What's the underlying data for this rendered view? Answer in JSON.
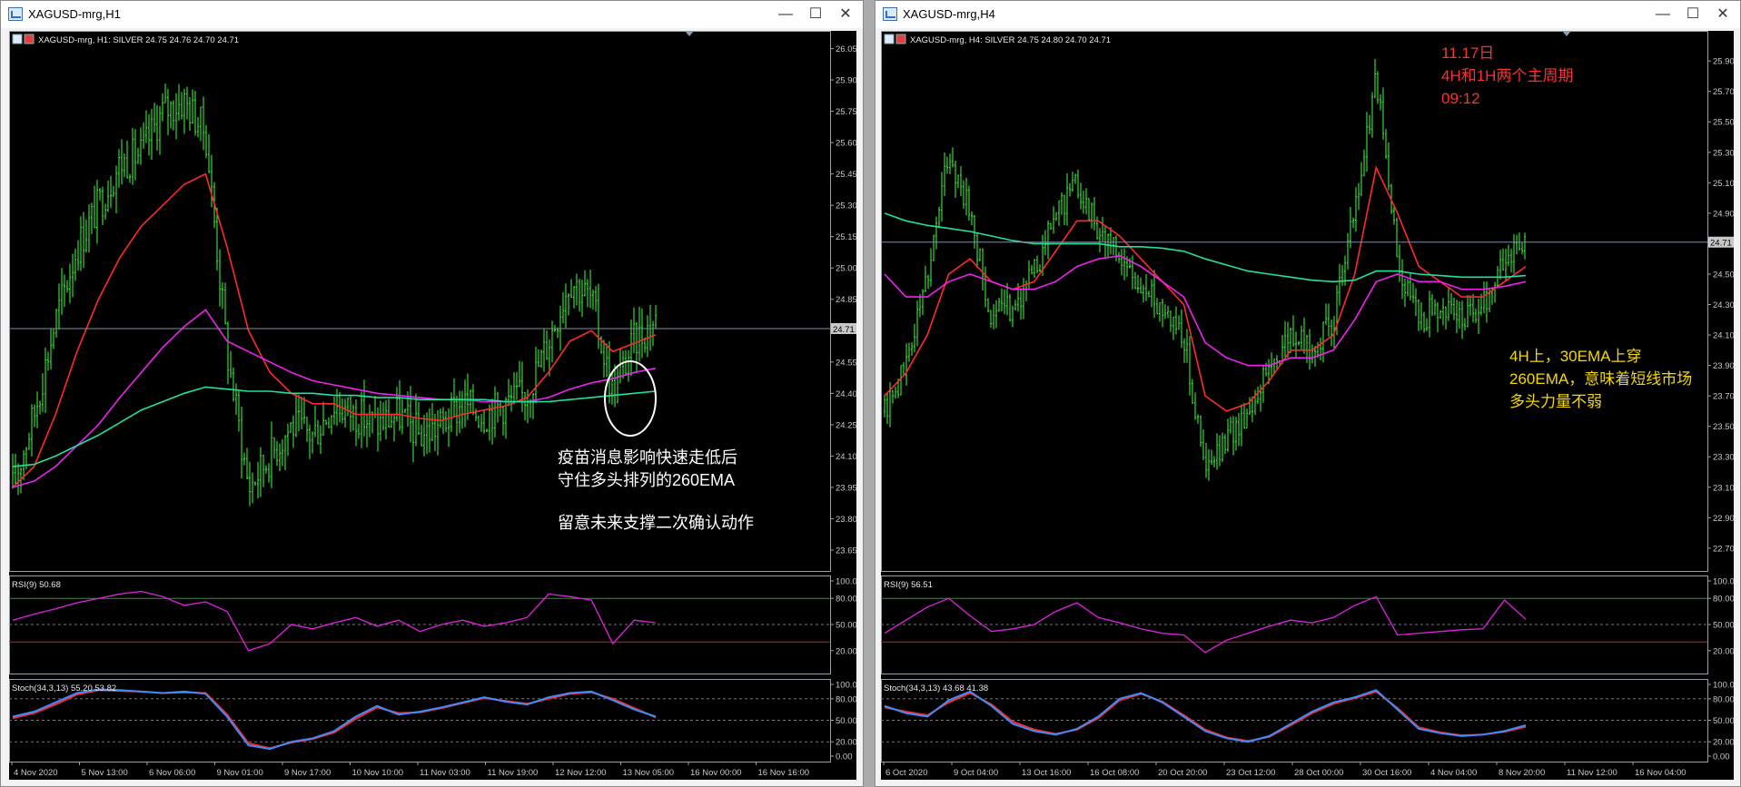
{
  "windows": [
    {
      "title": "XAGUSD-mrg,H1",
      "header": "XAGUSD-mrg, H1:  SILVER  24.75 24.76 24.70 24.71",
      "price_tag": "24.71",
      "rsi_label": "RSI(9) 50.68",
      "stoch_label": "Stoch(34,3,13) 55.20 53.82",
      "annotations": [
        {
          "text": "疫苗消息影响快速走低后",
          "color": "#ffffff"
        },
        {
          "text": "守住多头排列的260EMA",
          "color": "#ffffff"
        },
        {
          "text": "留意未来支撑二次确认动作",
          "color": "#ffffff"
        }
      ]
    },
    {
      "title": "XAGUSD-mrg,H4",
      "header": "XAGUSD-mrg, H4:  SILVER  24.75 24.80 24.70 24.71",
      "price_tag": "24.71",
      "rsi_label": "RSI(9) 56.51",
      "stoch_label": "Stoch(34,3,13) 43.68 41.38",
      "annotations": [
        {
          "text": "11.17日",
          "color": "#ff3030"
        },
        {
          "text": "4H和1H两个主周期",
          "color": "#ff3030"
        },
        {
          "text": "09:12",
          "color": "#ff3030"
        },
        {
          "text": "4H上，30EMA上穿",
          "color": "#f5d800"
        },
        {
          "text": "260EMA，意味着短线市场",
          "color": "#f5d800"
        },
        {
          "text": "多头力量不弱",
          "color": "#f5d800"
        }
      ]
    }
  ],
  "chart_data": [
    {
      "type": "line",
      "title": "XAGUSD-mrg, H1:  SILVER  24.75 24.76 24.70 24.71",
      "y_ticks": [
        "26.05",
        "25.90",
        "25.75",
        "25.60",
        "25.45",
        "25.30",
        "25.15",
        "25.00",
        "24.85",
        "24.70",
        "24.55",
        "24.40",
        "24.25",
        "24.10",
        "23.95",
        "23.80",
        "23.65"
      ],
      "ylim": [
        23.55,
        26.1
      ],
      "x_ticks": [
        "4 Nov 2020",
        "5 Nov 13:00",
        "6 Nov 06:00",
        "9 Nov 01:00",
        "9 Nov 17:00",
        "10 Nov 10:00",
        "11 Nov 03:00",
        "11 Nov 19:00",
        "12 Nov 12:00",
        "13 Nov 05:00",
        "16 Nov 00:00",
        "16 Nov 16:00"
      ],
      "current_price": 24.71,
      "series": [
        {
          "values": [
            23.95,
            24.3,
            24.75,
            25.1,
            25.3,
            25.5,
            25.55,
            25.75,
            25.8,
            25.65,
            24.6,
            23.95,
            24.1,
            24.25,
            24.2,
            24.35,
            24.3,
            24.25,
            24.3,
            24.2,
            24.25,
            24.35,
            24.3,
            24.35,
            24.4,
            24.65,
            24.95,
            24.85,
            24.4,
            24.65,
            24.75
          ]
        },
        {
          "values": [
            23.95,
            24.05,
            24.3,
            24.6,
            24.85,
            25.05,
            25.2,
            25.3,
            25.4,
            25.45,
            25.1,
            24.7,
            24.5,
            24.4,
            24.35,
            24.35,
            24.3,
            24.3,
            24.3,
            24.28,
            24.27,
            24.3,
            24.32,
            24.34,
            24.38,
            24.5,
            24.65,
            24.7,
            24.6,
            24.64,
            24.68
          ]
        },
        {
          "values": [
            23.95,
            23.98,
            24.05,
            24.15,
            24.25,
            24.38,
            24.5,
            24.62,
            24.72,
            24.8,
            24.65,
            24.6,
            24.55,
            24.5,
            24.46,
            24.44,
            24.42,
            24.4,
            24.39,
            24.38,
            24.37,
            24.37,
            24.36,
            24.36,
            24.36,
            24.38,
            24.42,
            24.45,
            24.47,
            24.5,
            24.52
          ]
        },
        {
          "values": [
            24.05,
            24.06,
            24.1,
            24.15,
            24.2,
            24.26,
            24.32,
            24.36,
            24.4,
            24.43,
            24.42,
            24.41,
            24.41,
            24.4,
            24.4,
            24.39,
            24.39,
            24.38,
            24.38,
            24.37,
            24.37,
            24.37,
            24.37,
            24.36,
            24.36,
            24.36,
            24.37,
            24.38,
            24.39,
            24.4,
            24.41
          ]
        }
      ],
      "rsi": {
        "ticks": [
          "100.00",
          "80.00",
          "50.00",
          "20.00"
        ],
        "values": [
          55,
          62,
          68,
          75,
          80,
          85,
          88,
          82,
          72,
          76,
          65,
          20,
          28,
          50,
          45,
          52,
          58,
          48,
          55,
          42,
          50,
          55,
          48,
          52,
          58,
          85,
          82,
          78,
          28,
          55,
          52
        ]
      },
      "stoch": {
        "ticks": [
          "100.00",
          "80.00",
          "50.00",
          "20.00",
          "0.00"
        ],
        "main": [
          55,
          62,
          75,
          88,
          93,
          92,
          90,
          88,
          90,
          87,
          55,
          15,
          10,
          20,
          25,
          35,
          55,
          70,
          58,
          62,
          68,
          75,
          82,
          76,
          72,
          82,
          88,
          90,
          78,
          65,
          55
        ],
        "signal": [
          53,
          60,
          72,
          86,
          92,
          91,
          90,
          88,
          89,
          88,
          58,
          18,
          11,
          19,
          24,
          33,
          52,
          68,
          60,
          61,
          67,
          74,
          81,
          77,
          73,
          80,
          87,
          89,
          80,
          67,
          54
        ]
      }
    },
    {
      "type": "line",
      "title": "XAGUSD-mrg, H4:  SILVER  24.75 24.80 24.70 24.71",
      "y_ticks": [
        "25.90",
        "25.70",
        "25.50",
        "25.30",
        "25.10",
        "24.90",
        "24.70",
        "24.50",
        "24.30",
        "24.10",
        "23.90",
        "23.70",
        "23.50",
        "23.30",
        "23.10",
        "22.90",
        "22.70"
      ],
      "ylim": [
        22.55,
        26.05
      ],
      "x_ticks": [
        "6 Oct 2020",
        "9 Oct 04:00",
        "13 Oct 16:00",
        "16 Oct 08:00",
        "20 Oct 20:00",
        "23 Oct 12:00",
        "28 Oct 00:00",
        "30 Oct 16:00",
        "4 Nov 04:00",
        "8 Nov 20:00",
        "11 Nov 12:00",
        "16 Nov 04:00"
      ],
      "current_price": 24.71,
      "series": [
        {
          "values": [
            23.6,
            23.9,
            24.5,
            25.3,
            24.9,
            24.2,
            24.3,
            24.5,
            24.9,
            25.1,
            24.8,
            24.6,
            24.4,
            24.3,
            24.1,
            23.2,
            23.4,
            23.6,
            23.9,
            24.1,
            24.0,
            24.2,
            24.9,
            25.8,
            24.6,
            24.2,
            24.3,
            24.2,
            24.3,
            24.6,
            24.75
          ]
        },
        {
          "values": [
            23.7,
            23.85,
            24.1,
            24.5,
            24.6,
            24.45,
            24.4,
            24.45,
            24.65,
            24.85,
            24.85,
            24.75,
            24.6,
            24.45,
            24.3,
            23.7,
            23.6,
            23.65,
            23.8,
            24.0,
            24.0,
            24.1,
            24.5,
            25.2,
            24.9,
            24.55,
            24.45,
            24.35,
            24.35,
            24.45,
            24.55
          ]
        },
        {
          "values": [
            24.5,
            24.35,
            24.35,
            24.45,
            24.5,
            24.45,
            24.4,
            24.4,
            24.45,
            24.55,
            24.6,
            24.62,
            24.55,
            24.45,
            24.35,
            24.05,
            23.95,
            23.9,
            23.9,
            23.95,
            23.95,
            24.0,
            24.2,
            24.45,
            24.5,
            24.45,
            24.45,
            24.4,
            24.4,
            24.42,
            24.45
          ]
        },
        {
          "values": [
            24.9,
            24.85,
            24.82,
            24.8,
            24.78,
            24.75,
            24.72,
            24.7,
            24.7,
            24.7,
            24.7,
            24.68,
            24.68,
            24.67,
            24.65,
            24.6,
            24.56,
            24.52,
            24.5,
            24.48,
            24.46,
            24.45,
            24.46,
            24.52,
            24.52,
            24.5,
            24.49,
            24.48,
            24.48,
            24.48,
            24.49
          ]
        }
      ],
      "rsi": {
        "ticks": [
          "100.00",
          "80.00",
          "50.00",
          "20.00"
        ],
        "values": [
          40,
          55,
          70,
          80,
          60,
          42,
          45,
          50,
          65,
          75,
          58,
          52,
          45,
          40,
          38,
          18,
          32,
          40,
          48,
          55,
          52,
          58,
          72,
          82,
          38,
          40,
          42,
          44,
          45,
          78,
          56
        ]
      },
      "stoch": {
        "ticks": [
          "100.00",
          "80.00",
          "50.00",
          "20.00",
          "0.00"
        ],
        "main": [
          70,
          60,
          55,
          78,
          90,
          70,
          45,
          35,
          30,
          38,
          55,
          80,
          88,
          75,
          55,
          35,
          25,
          20,
          28,
          45,
          62,
          75,
          82,
          92,
          65,
          38,
          32,
          28,
          30,
          35,
          43
        ],
        "signal": [
          68,
          62,
          57,
          75,
          88,
          72,
          48,
          37,
          31,
          37,
          53,
          78,
          87,
          76,
          57,
          37,
          26,
          21,
          27,
          43,
          60,
          73,
          81,
          90,
          67,
          40,
          33,
          29,
          30,
          34,
          41
        ]
      }
    }
  ]
}
